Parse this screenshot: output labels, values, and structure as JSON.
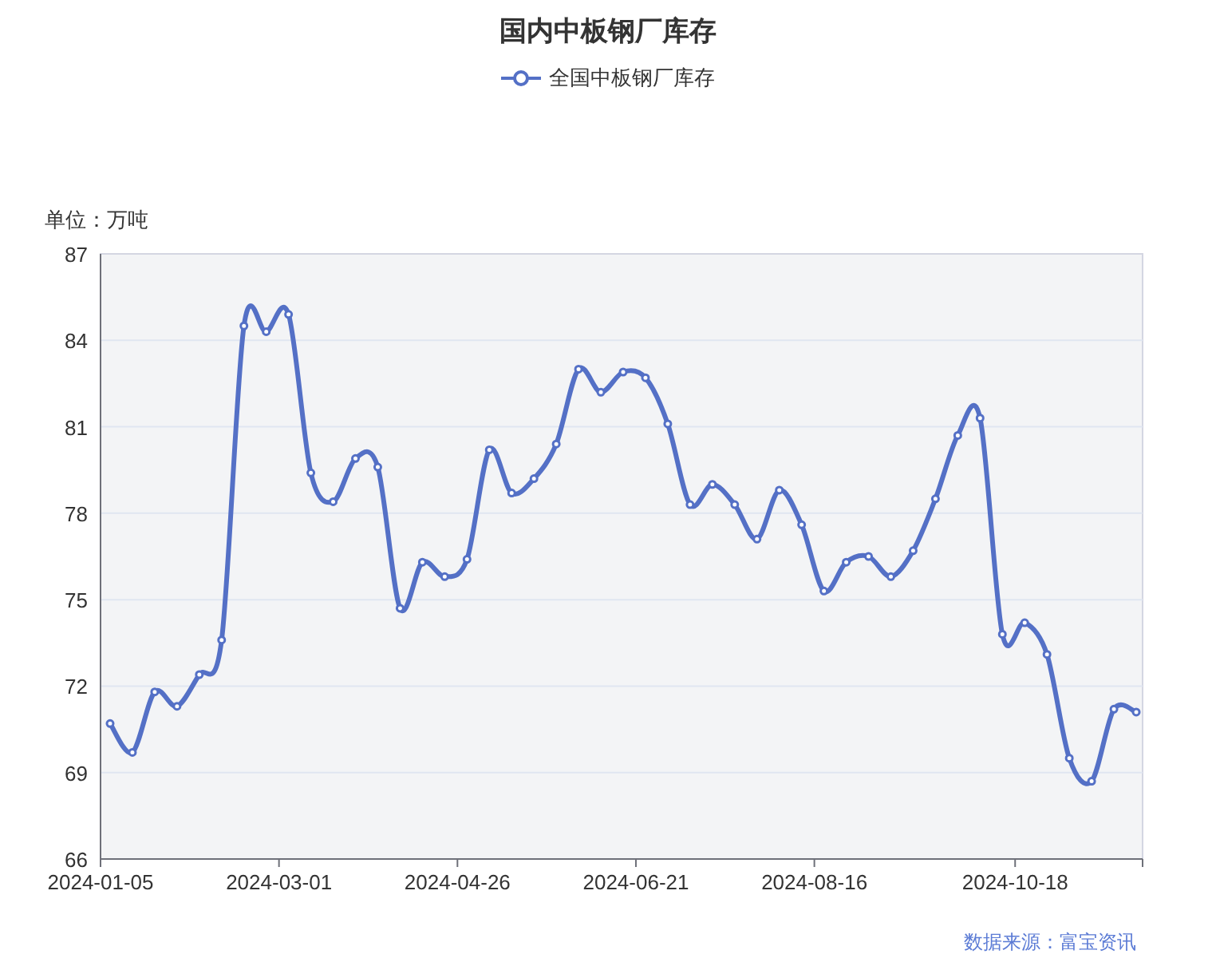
{
  "title": "国内中板钢厂库存",
  "chart_data": {
    "type": "line",
    "ylabel": "单位：万吨",
    "x": [
      "2024-01-08",
      "2024-01-15",
      "2024-01-22",
      "2024-01-29",
      "2024-02-05",
      "2024-02-12",
      "2024-02-19",
      "2024-02-26",
      "2024-03-04",
      "2024-03-11",
      "2024-03-18",
      "2024-03-25",
      "2024-04-01",
      "2024-04-08",
      "2024-04-15",
      "2024-04-22",
      "2024-04-29",
      "2024-05-06",
      "2024-05-13",
      "2024-05-20",
      "2024-05-27",
      "2024-06-03",
      "2024-06-10",
      "2024-06-17",
      "2024-06-24",
      "2024-07-01",
      "2024-07-08",
      "2024-07-15",
      "2024-07-22",
      "2024-07-29",
      "2024-08-05",
      "2024-08-12",
      "2024-08-19",
      "2024-08-26",
      "2024-09-02",
      "2024-09-09",
      "2024-09-16",
      "2024-09-23",
      "2024-09-30",
      "2024-10-07",
      "2024-10-14",
      "2024-10-21",
      "2024-10-28",
      "2024-11-04",
      "2024-11-11",
      "2024-11-18",
      "2024-11-25"
    ],
    "xlim": [
      "2024-01-05",
      "2024-11-27"
    ],
    "grid": true,
    "series": [
      {
        "name": "全国中板钢厂库存",
        "color": "#5470c6",
        "marker": "circle",
        "values": [
          70.7,
          69.7,
          71.8,
          71.3,
          72.4,
          73.6,
          84.5,
          84.3,
          84.9,
          79.4,
          78.4,
          79.9,
          79.6,
          74.7,
          76.3,
          75.8,
          76.4,
          80.2,
          78.7,
          79.2,
          80.4,
          83.0,
          82.2,
          82.9,
          82.7,
          81.1,
          78.3,
          79.0,
          78.3,
          77.1,
          78.8,
          77.6,
          75.3,
          76.3,
          76.5,
          75.8,
          76.7,
          78.5,
          80.7,
          81.3,
          73.8,
          74.2,
          73.1,
          69.5,
          68.7,
          71.2,
          71.1
        ]
      }
    ],
    "xticks": [
      {
        "value": "2024-01-05",
        "label": "2024-01-05"
      },
      {
        "value": "2024-03-01",
        "label": "2024-03-01"
      },
      {
        "value": "2024-04-26",
        "label": "2024-04-26"
      },
      {
        "value": "2024-06-21",
        "label": "2024-06-21"
      },
      {
        "value": "2024-08-16",
        "label": "2024-08-16"
      },
      {
        "value": "2024-10-18",
        "label": "2024-10-18"
      }
    ],
    "ylim": [
      66,
      87
    ],
    "yticks": [
      66,
      69,
      72,
      75,
      78,
      81,
      84,
      87
    ]
  },
  "source": "数据来源：富宝资讯"
}
